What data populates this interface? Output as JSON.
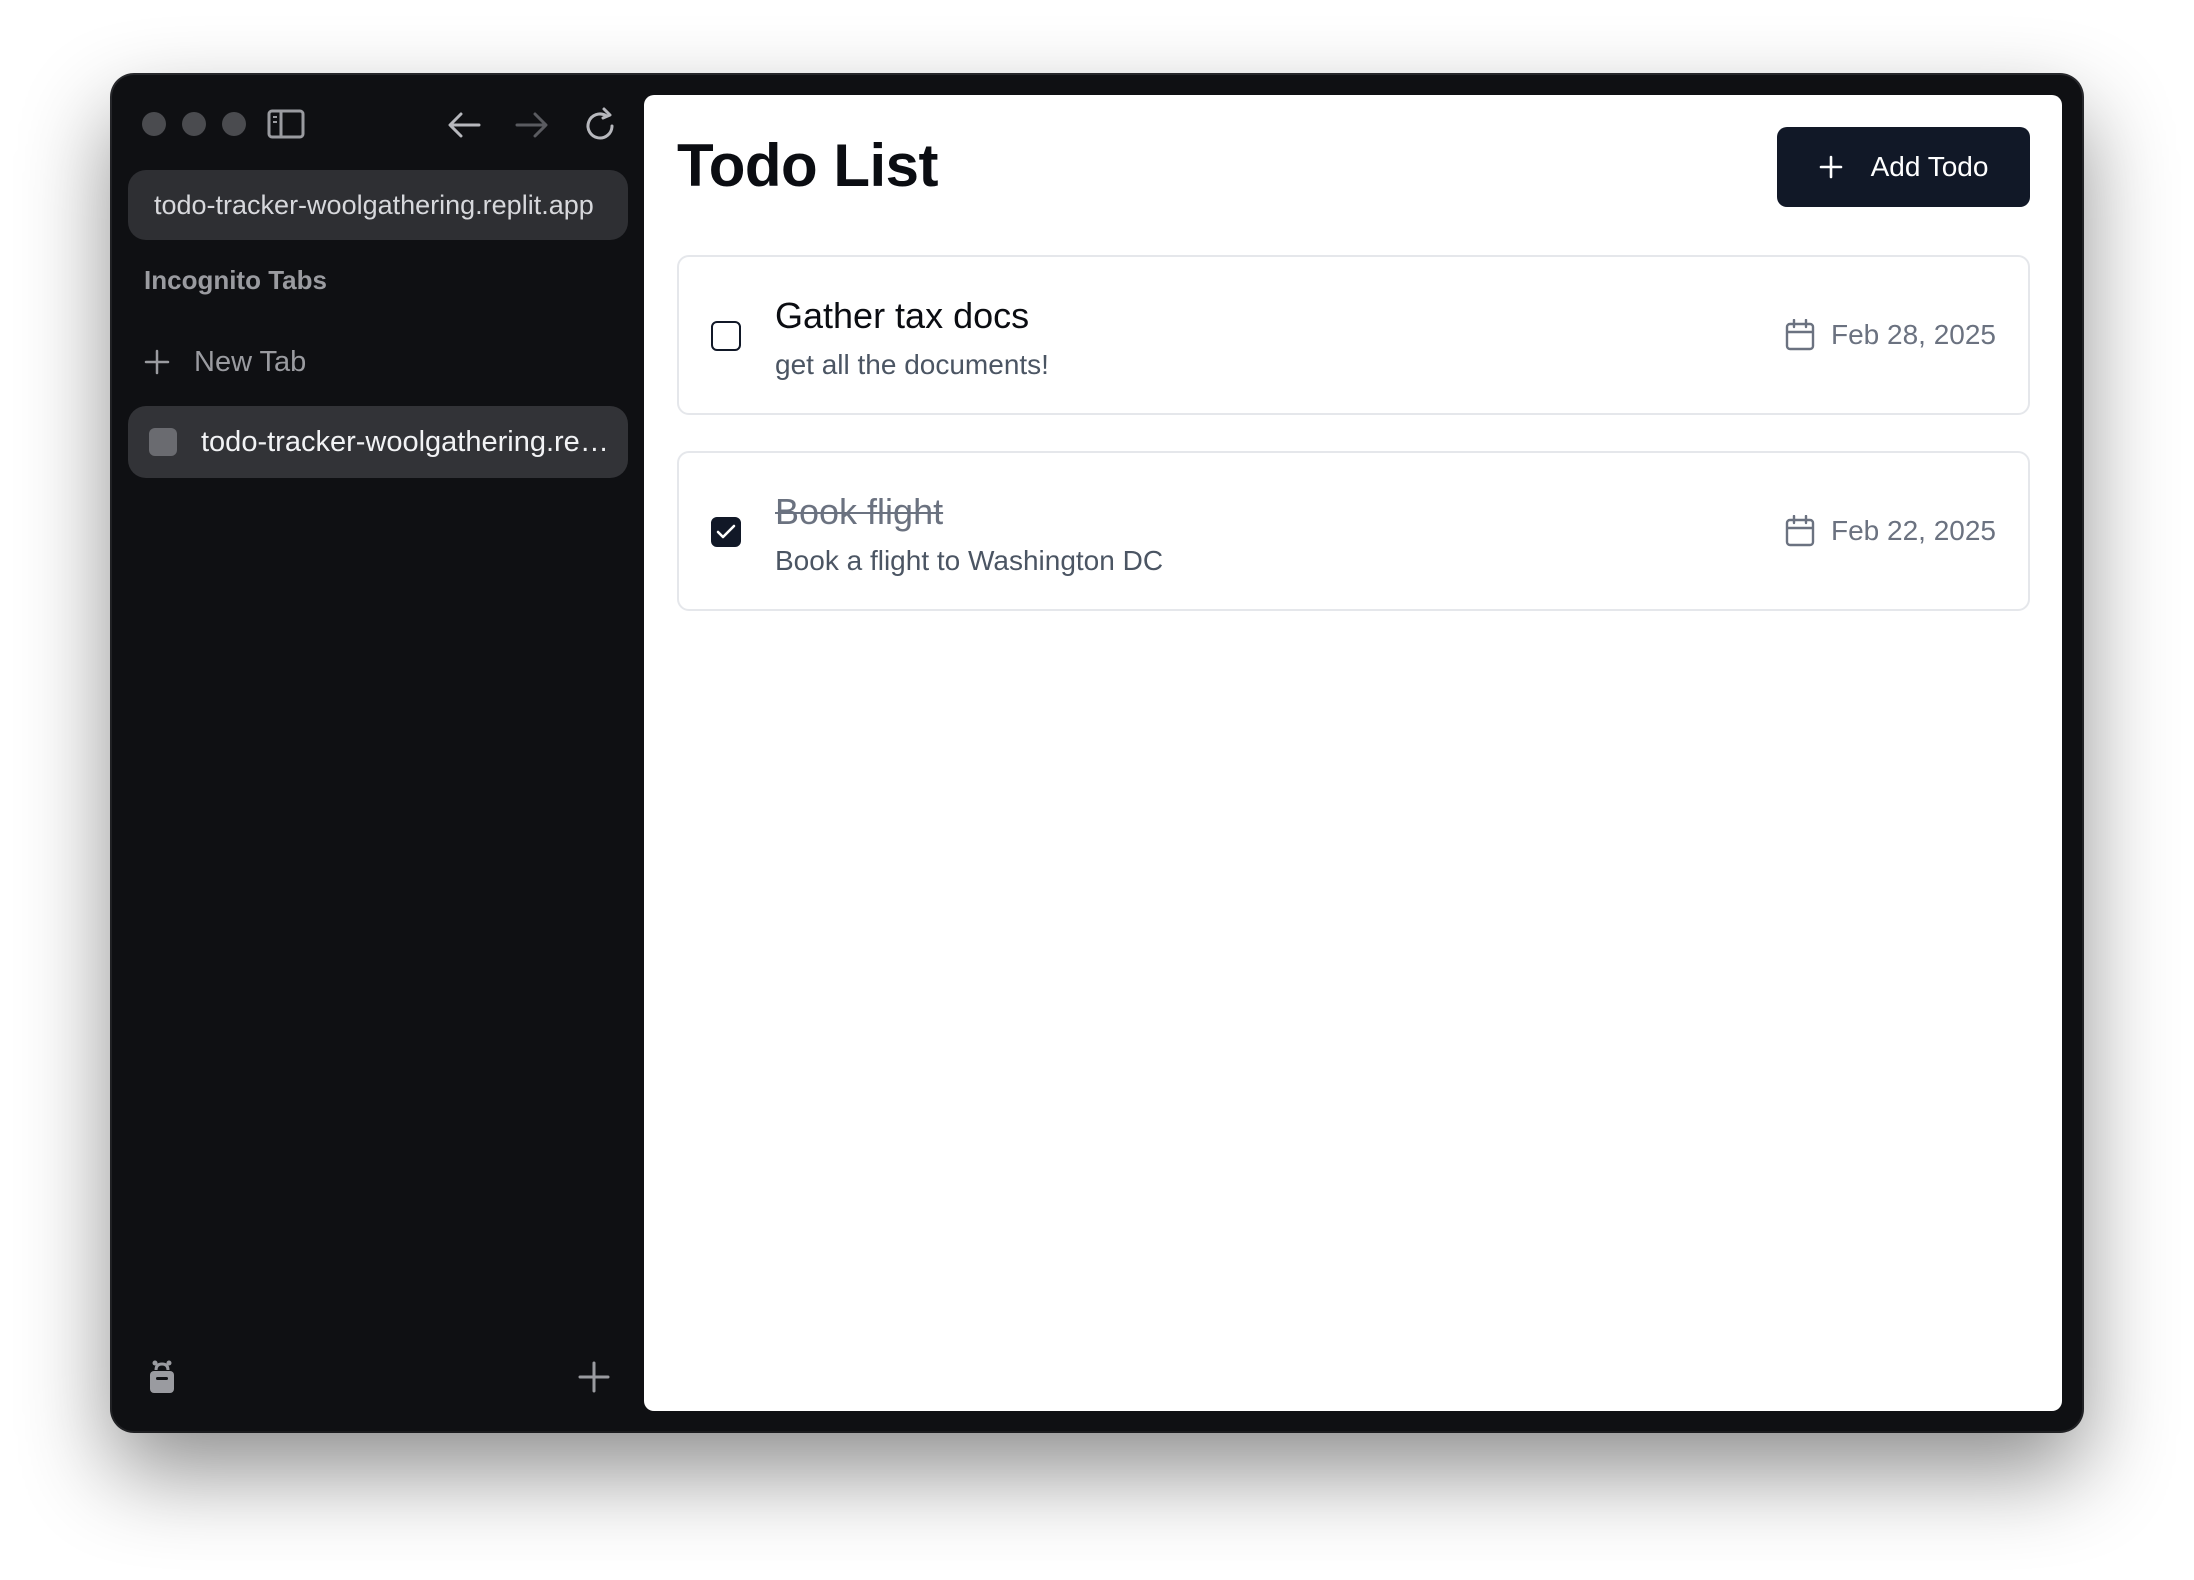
{
  "browser": {
    "url": "todo-tracker-woolgathering.replit.app",
    "section_label": "Incognito Tabs",
    "new_tab_label": "New Tab",
    "tabs": [
      {
        "title": "todo-tracker-woolgathering.replit.app"
      }
    ]
  },
  "page": {
    "title": "Todo List",
    "add_button_label": "Add Todo"
  },
  "todos": [
    {
      "title": "Gather tax docs",
      "description": "get all the documents!",
      "date": "Feb 28, 2025",
      "completed": false
    },
    {
      "title": "Book flight",
      "description": "Book a flight to Washington DC",
      "date": "Feb 22, 2025",
      "completed": true
    }
  ],
  "colors": {
    "window_bg": "#0f1013",
    "button_bg": "#111827",
    "muted_text": "#6b7280"
  }
}
